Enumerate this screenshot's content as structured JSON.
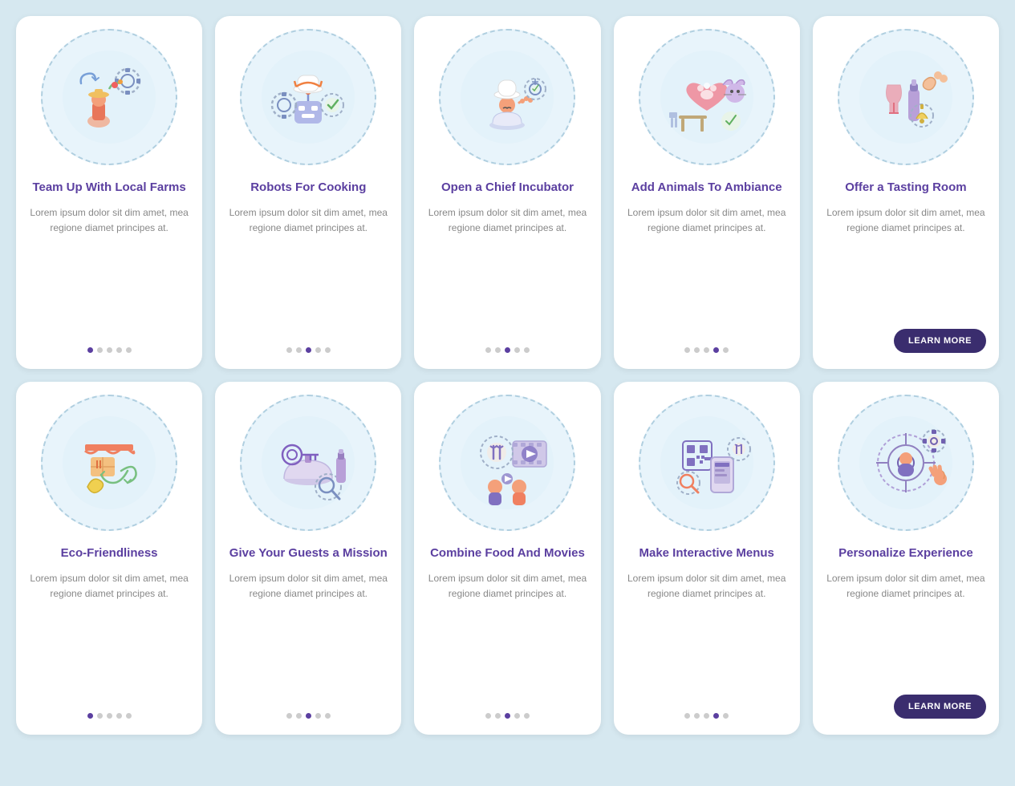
{
  "cards": [
    {
      "id": "team-up",
      "title": "Team Up With Local Farms",
      "body": "Lorem ipsum dolor sit dim amet, mea regione diamet principes at.",
      "dots": [
        true,
        false,
        false,
        false,
        false
      ],
      "hasLearnMore": false,
      "row": 1
    },
    {
      "id": "robots-cooking",
      "title": "Robots For Cooking",
      "body": "Lorem ipsum dolor sit dim amet, mea regione diamet principes at.",
      "dots": [
        false,
        false,
        true,
        false,
        false
      ],
      "hasLearnMore": false,
      "row": 1
    },
    {
      "id": "chief-incubator",
      "title": "Open a Chief Incubator",
      "body": "Lorem ipsum dolor sit dim amet, mea regione diamet principes at.",
      "dots": [
        false,
        false,
        true,
        false,
        false
      ],
      "hasLearnMore": false,
      "row": 1
    },
    {
      "id": "animals-ambiance",
      "title": "Add Animals To Ambiance",
      "body": "Lorem ipsum dolor sit dim amet, mea regione diamet principes at.",
      "dots": [
        false,
        false,
        false,
        true,
        false
      ],
      "hasLearnMore": false,
      "row": 1
    },
    {
      "id": "tasting-room",
      "title": "Offer a Tasting Room",
      "body": "Lorem ipsum dolor sit dim amet, mea regione diamet principes at.",
      "dots": [],
      "hasLearnMore": true,
      "learnMoreLabel": "LEARN MORE",
      "row": 1
    },
    {
      "id": "eco-friendliness",
      "title": "Eco-Friendliness",
      "body": "Lorem ipsum dolor sit dim amet, mea regione diamet principes at.",
      "dots": [
        true,
        false,
        false,
        false,
        false
      ],
      "hasLearnMore": false,
      "row": 2
    },
    {
      "id": "guests-mission",
      "title": "Give Your Guests a Mission",
      "body": "Lorem ipsum dolor sit dim amet, mea regione diamet principes at.",
      "dots": [
        false,
        false,
        true,
        false,
        false
      ],
      "hasLearnMore": false,
      "row": 2
    },
    {
      "id": "food-movies",
      "title": "Combine Food And Movies",
      "body": "Lorem ipsum dolor sit dim amet, mea regione diamet principes at.",
      "dots": [
        false,
        false,
        true,
        false,
        false
      ],
      "hasLearnMore": false,
      "row": 2
    },
    {
      "id": "interactive-menus",
      "title": "Make Interactive Menus",
      "body": "Lorem ipsum dolor sit dim amet, mea regione diamet principes at.",
      "dots": [
        false,
        false,
        false,
        true,
        false
      ],
      "hasLearnMore": false,
      "row": 2
    },
    {
      "id": "personalize-experience",
      "title": "Personalize Experience",
      "body": "Lorem ipsum dolor sit dim amet, mea regione diamet principes at.",
      "dots": [],
      "hasLearnMore": true,
      "learnMoreLabel": "LEARN MORE",
      "row": 2
    }
  ]
}
